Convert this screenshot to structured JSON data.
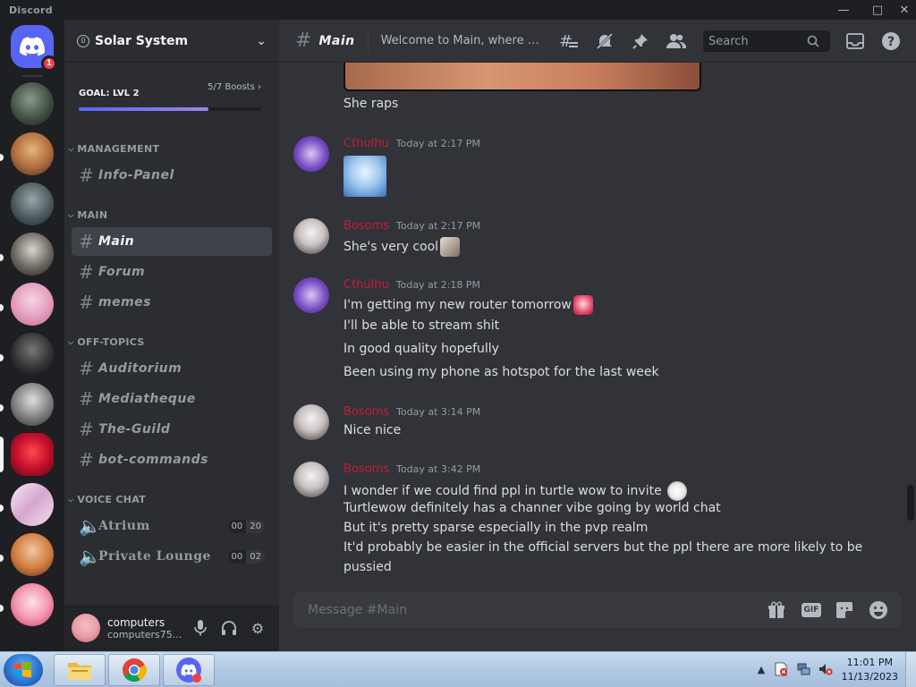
{
  "window": {
    "title": "Discord"
  },
  "guilds": {
    "home_badge": "1"
  },
  "server": {
    "name": "Solar System",
    "badge": "0"
  },
  "boost": {
    "goal": "GOAL: LVL 2",
    "progress_label": "5/7 Boosts",
    "progress_fraction": 0.71
  },
  "categories": {
    "management": "MANAGEMENT",
    "main": "MAIN",
    "offtopics": "OFF-TOPICS",
    "voice": "VOICE CHAT"
  },
  "channels": {
    "info_panel": "Info-Panel",
    "main": "Main",
    "forum": "Forum",
    "memes": "memes",
    "auditorium": "Auditorium",
    "mediatheque": "Mediatheque",
    "the_guild": "The-Guild",
    "bot_commands": "bot-commands",
    "atrium": "Atrium",
    "atrium_count": "00",
    "atrium_limit": "20",
    "private_lounge": "Private Lounge",
    "lounge_count": "00",
    "lounge_limit": "02"
  },
  "user": {
    "name": "computers",
    "tag": "computers75..."
  },
  "header": {
    "channel": "Main",
    "topic": "Welcome to Main, where yo...",
    "search_placeholder": "Search"
  },
  "messages": {
    "m0_line": "She raps",
    "m1_author": "Cthulhu",
    "m1_time": "Today at 2:17 PM",
    "m2_author": "Bosoms",
    "m2_time": "Today at 2:17 PM",
    "m2_line": "She's very cool",
    "m3_author": "Cthulhu",
    "m3_time": "Today at 2:18 PM",
    "m3_lines": [
      "I'm getting my new router tomorrow",
      "I'll be able to stream shit",
      "In good quality hopefully",
      "Been using my phone as hotspot for the last week"
    ],
    "m4_author": "Bosoms",
    "m4_time": "Today at 3:14 PM",
    "m4_line": "Nice nice",
    "m5_author": "Bosoms",
    "m5_time": "Today at 3:42 PM",
    "m5_lines": [
      "I wonder if we could find ppl in turtle wow to invite",
      "Turtlewow definitely has a channer vibe going by world chat",
      "But it's pretty sparse especially in the pvp realm",
      "It'd probably be easier in the official servers but the ppl there are more likely to be",
      "pussied"
    ]
  },
  "composer": {
    "placeholder": "Message #Main",
    "gif_label": "GIF"
  },
  "taskbar": {
    "time": "11:01 PM",
    "date": "11/13/2023"
  },
  "colors": {
    "accent": "#5865f2",
    "author_red": "#c41d3a",
    "badge_red": "#f23f43"
  }
}
